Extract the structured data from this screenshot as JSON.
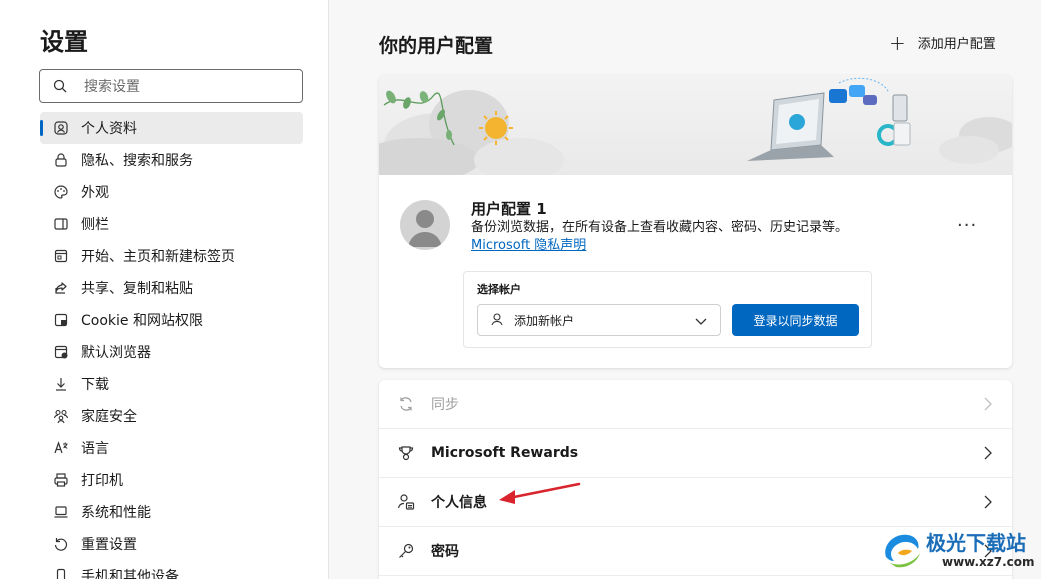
{
  "sidebar": {
    "title": "设置",
    "search_placeholder": "搜索设置",
    "items": [
      {
        "label": "个人资料",
        "icon": "profile-icon",
        "active": true
      },
      {
        "label": "隐私、搜索和服务",
        "icon": "lock-icon"
      },
      {
        "label": "外观",
        "icon": "palette-icon"
      },
      {
        "label": "侧栏",
        "icon": "sidebar-icon"
      },
      {
        "label": "开始、主页和新建标签页",
        "icon": "home-icon"
      },
      {
        "label": "共享、复制和粘贴",
        "icon": "share-icon"
      },
      {
        "label": "Cookie 和网站权限",
        "icon": "cookie-icon"
      },
      {
        "label": "默认浏览器",
        "icon": "browser-icon"
      },
      {
        "label": "下载",
        "icon": "download-icon"
      },
      {
        "label": "家庭安全",
        "icon": "family-icon"
      },
      {
        "label": "语言",
        "icon": "language-icon"
      },
      {
        "label": "打印机",
        "icon": "printer-icon"
      },
      {
        "label": "系统和性能",
        "icon": "laptop-icon"
      },
      {
        "label": "重置设置",
        "icon": "reset-icon"
      },
      {
        "label": "手机和其他设备",
        "icon": "phone-icon"
      }
    ]
  },
  "main": {
    "title": "你的用户配置",
    "add_profile_label": "添加用户配置",
    "profile": {
      "name": "用户配置 1",
      "description": "备份浏览数据，在所有设备上查看收藏内容、密码、历史记录等。",
      "privacy_link": "Microsoft 隐私声明",
      "more_label": "···",
      "account_label": "选择帐户",
      "account_select_value": "添加新帐户",
      "sync_button": "登录以同步数据"
    },
    "settings_rows": [
      {
        "label": "同步",
        "icon": "sync-icon",
        "disabled": true
      },
      {
        "label": "Microsoft Rewards",
        "icon": "trophy-icon",
        "disabled": false
      },
      {
        "label": "个人信息",
        "icon": "personal-info-icon",
        "disabled": false
      },
      {
        "label": "密码",
        "icon": "key-icon",
        "disabled": false
      }
    ]
  },
  "watermark": {
    "text": "极光下载站",
    "url": "www.xz7.com"
  },
  "colors": {
    "accent": "#0067c0",
    "annotation_arrow": "#d9232d"
  }
}
